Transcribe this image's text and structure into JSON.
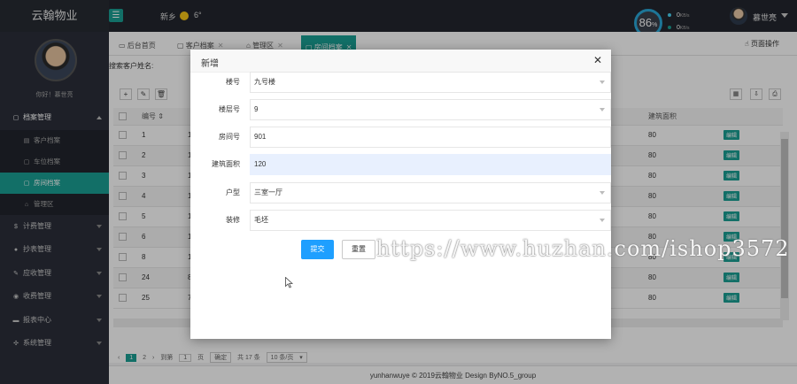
{
  "app": {
    "title": "云翰物业"
  },
  "topbar": {
    "city": "新乡",
    "weather_icon": "sun-icon",
    "temperature": "6°",
    "gauge_value": "86",
    "gauge_unit": "%",
    "net_up": "0",
    "net_down": "0",
    "net_unit": "KB/s",
    "user_name": "慕世亮"
  },
  "sidebar": {
    "greeting": "你好！慕世亮",
    "items": [
      {
        "label": "档案管理",
        "icon": "doc-icon",
        "expanded": true
      },
      {
        "label": "客户档案",
        "icon": "list-icon"
      },
      {
        "label": "车位档案",
        "icon": "doc-icon"
      },
      {
        "label": "房间档案",
        "icon": "doc-icon",
        "active": true
      },
      {
        "label": "管理区",
        "icon": "home-icon"
      },
      {
        "label": "计费管理",
        "icon": "money-icon"
      },
      {
        "label": "抄表管理",
        "icon": "gear-icon"
      },
      {
        "label": "应收管理",
        "icon": "edit-icon"
      },
      {
        "label": "收费管理",
        "icon": "circle-icon"
      },
      {
        "label": "报表中心",
        "icon": "chart-icon"
      },
      {
        "label": "系统管理",
        "icon": "settings-icon"
      }
    ]
  },
  "tabs": [
    {
      "label": "后台首页",
      "icon": "monitor-icon"
    },
    {
      "label": "客户档案",
      "icon": "doc-icon"
    },
    {
      "label": "管理区",
      "icon": "home-icon"
    },
    {
      "label": "房间档案",
      "icon": "doc-icon",
      "active": true
    }
  ],
  "page_operation": "页面操作",
  "search": {
    "label": "搜索客户姓名:"
  },
  "table": {
    "headers": [
      "编号",
      "建筑面积"
    ],
    "rows": [
      {
        "id": "1",
        "c2": "1",
        "area": "80"
      },
      {
        "id": "2",
        "c2": "1",
        "area": "80"
      },
      {
        "id": "3",
        "c2": "1",
        "area": "80"
      },
      {
        "id": "4",
        "c2": "1",
        "area": "80"
      },
      {
        "id": "5",
        "c2": "1",
        "area": "80"
      },
      {
        "id": "6",
        "c2": "1",
        "area": "80"
      },
      {
        "id": "8",
        "c2": "1",
        "area": "80"
      },
      {
        "id": "24",
        "c2": "8",
        "area": "80"
      },
      {
        "id": "25",
        "c2": "7",
        "area": "80"
      }
    ],
    "edit_label": "编辑"
  },
  "pager": {
    "current": "1",
    "next": "2",
    "goto": "到第",
    "page_input": "1",
    "page_suffix": "页",
    "confirm": "确定",
    "total": "共 17 条",
    "page_size": "10 条/页"
  },
  "footer": "yunhanwuye © 2019云翰物业 Design ByNO.5_group",
  "modal": {
    "title": "新增",
    "fields": [
      {
        "label": "楼号",
        "value": "九号楼",
        "type": "select"
      },
      {
        "label": "楼层号",
        "value": "9",
        "type": "select"
      },
      {
        "label": "房间号",
        "value": "901",
        "type": "input"
      },
      {
        "label": "建筑面积",
        "value": "120",
        "type": "input"
      },
      {
        "label": "户型",
        "value": "三室一厅",
        "type": "select"
      },
      {
        "label": "装修",
        "value": "毛坯",
        "type": "select"
      }
    ],
    "submit": "提交",
    "reset": "重置"
  },
  "watermark": "https://www.huzhan.com/ishop3572",
  "colors": {
    "accent": "#1aa094",
    "primary": "#1e9fff",
    "dark": "#23262e"
  }
}
